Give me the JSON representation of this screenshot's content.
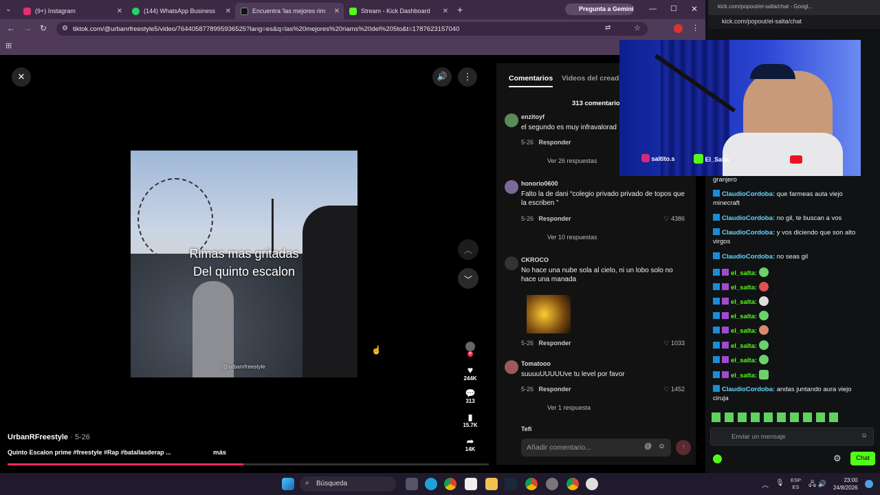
{
  "tabs": [
    {
      "label": "(9+) Instagram",
      "color": "#e1306c"
    },
    {
      "label": "(144) WhatsApp Business",
      "color": "#25d366"
    },
    {
      "label": "Encuentra 'las mejores rim",
      "color": "#222222"
    },
    {
      "label": "Stream - Kick Dashboard",
      "color": "#53fc18"
    }
  ],
  "gemini_button": "Pregunta a Gemini",
  "url": "tiktok.com/@urbanrfreestyle5/video/7644058778995936525?lang=es&q=las%20mejores%20riams%20del%205to&t=1787623157040",
  "video": {
    "overlay_line1": "Rimas mas gritadas",
    "overlay_line2": "Del quinto escalon",
    "watermark": "@urbanrfreestyle",
    "author": "UrbanRFreestyle",
    "date": "· 5-26",
    "caption": "Quinto Escalon prime #freestyle #Rap #batallasderap ...",
    "more": "más",
    "progress": 0.49
  },
  "side_actions": {
    "likes": "244K",
    "comments": "313",
    "saves": "15.7K",
    "shares": "14K"
  },
  "comments_panel": {
    "tab_comments": "Comentarios",
    "tab_videos": "Videos del creado",
    "count": "313 comentarios",
    "reply_label": "Responder",
    "input_placeholder": "Añadir comentario...",
    "items": [
      {
        "user": "enzitoyf",
        "text": "el segundo es muy infravalorad",
        "date": "5-26",
        "likes": "",
        "replies": "Ver 26 respuestas",
        "color": "#5a8a5a"
      },
      {
        "user": "honorio0600",
        "text": "Falto la de dani “colegio privado privado de topos que la escriben ”",
        "date": "5-26",
        "likes": "4386",
        "replies": "Ver 10 respuestas",
        "color": "#7a6a9a"
      },
      {
        "user": "CKROCO",
        "text": "No hace una nube sola al cielo, ni un lobo solo no hace una manada",
        "date": "5-26",
        "likes": "1033",
        "replies": "",
        "color": "#333333"
      },
      {
        "user": "Tomatooo",
        "text": "suuuuUUUUUve tu level por favor",
        "date": "5-26",
        "likes": "1452",
        "replies": "Ver 1 respuesta",
        "color": "#9a5a5a"
      },
      {
        "user": "Tefi",
        "text": "",
        "date": "",
        "likes": "",
        "replies": "",
        "color": "#555555"
      }
    ]
  },
  "kick": {
    "window_url": "kick.com/popout/el-salta/chat - Googl...",
    "url": "kick.com/popout/el-salta/chat",
    "header": "Chat",
    "cam_labels": [
      "saltito.s",
      "El_Salta"
    ],
    "messages": [
      {
        "user": "",
        "text": "granjero"
      },
      {
        "user": "ClaudioCordoba:",
        "text": "que farmeas auta viejo minecraft"
      },
      {
        "user": "ClaudioCordoba:",
        "text": "no gil, te buscan a vos"
      },
      {
        "user": "ClaudioCordoba:",
        "text": "y vos diciendo que son alto virgos"
      },
      {
        "user": "ClaudioCordoba:",
        "text": "no seas gil"
      },
      {
        "user": "el_salta:",
        "text": ""
      },
      {
        "user": "el_salta:",
        "text": ""
      },
      {
        "user": "el_salta:",
        "text": ""
      },
      {
        "user": "el_salta:",
        "text": ""
      },
      {
        "user": "el_salta:",
        "text": ""
      },
      {
        "user": "el_salta:",
        "text": ""
      },
      {
        "user": "el_salta:",
        "text": ""
      },
      {
        "user": "el_salta:",
        "text": ""
      },
      {
        "user": "ClaudioCordoba:",
        "text": "andas juntando aura viejo ciruja"
      }
    ],
    "input_placeholder": "Enviar un mensaje",
    "chat_button": "Chat"
  },
  "taskbar": {
    "search": "Búsqueda",
    "lang1": "ESP",
    "lang2": "ES",
    "time": "23:00",
    "date": "24/8/2026"
  }
}
